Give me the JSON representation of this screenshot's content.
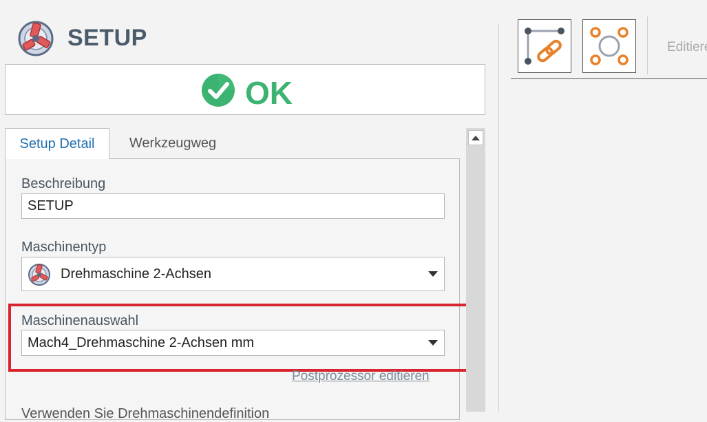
{
  "header": {
    "title": "SETUP",
    "app_icon": "lathe-setup-icon"
  },
  "status": {
    "text": "OK",
    "icon": "check-circle-icon",
    "color": "#3cb371"
  },
  "tabs": [
    {
      "label": "Setup Detail",
      "active": true
    },
    {
      "label": "Werkzeugweg",
      "active": false
    }
  ],
  "form": {
    "beschreibung": {
      "label": "Beschreibung",
      "value": "SETUP"
    },
    "maschinentyp": {
      "label": "Maschinentyp",
      "value": "Drehmaschine 2-Achsen",
      "icon": "lathe-icon"
    },
    "maschinenauswahl": {
      "label": "Maschinenauswahl",
      "value": "Mach4_Drehmaschine 2-Achsen mm"
    },
    "postprozessor_link": "Postprozessor editieren",
    "cut_off_text": "Verwenden Sie Drehmaschinendefinition"
  },
  "toolbar": {
    "edit_label": "Editieren",
    "buttons": [
      {
        "name": "link-geometry-button",
        "icon": "link-icon"
      },
      {
        "name": "circle-points-button",
        "icon": "circle-points-icon"
      }
    ]
  },
  "colors": {
    "accent_blue": "#1e6fb0",
    "highlight_red": "#d9252f",
    "icon_orange": "#e8822a"
  }
}
